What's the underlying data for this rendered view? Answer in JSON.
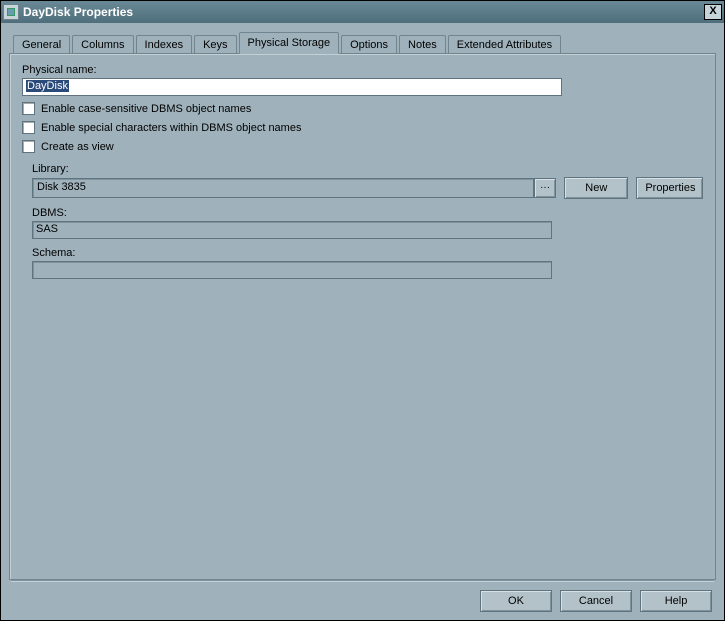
{
  "window": {
    "title": "DayDisk Properties",
    "close_label": "X"
  },
  "tabs": [
    "General",
    "Columns",
    "Indexes",
    "Keys",
    "Physical Storage",
    "Options",
    "Notes",
    "Extended Attributes"
  ],
  "active_tab": "Physical Storage",
  "form": {
    "physical_name_label": "Physical name:",
    "physical_name_value": "DayDisk",
    "chk_case_label": "Enable case-sensitive DBMS object names",
    "chk_special_label": "Enable special characters within DBMS object names",
    "chk_view_label": "Create as view",
    "library_label": "Library:",
    "library_value": "Disk 3835",
    "browse_label": "...",
    "new_label": "New",
    "properties_label": "Properties",
    "dbms_label": "DBMS:",
    "dbms_value": "SAS",
    "schema_label": "Schema:",
    "schema_value": ""
  },
  "buttons": {
    "ok": "OK",
    "cancel": "Cancel",
    "help": "Help"
  }
}
